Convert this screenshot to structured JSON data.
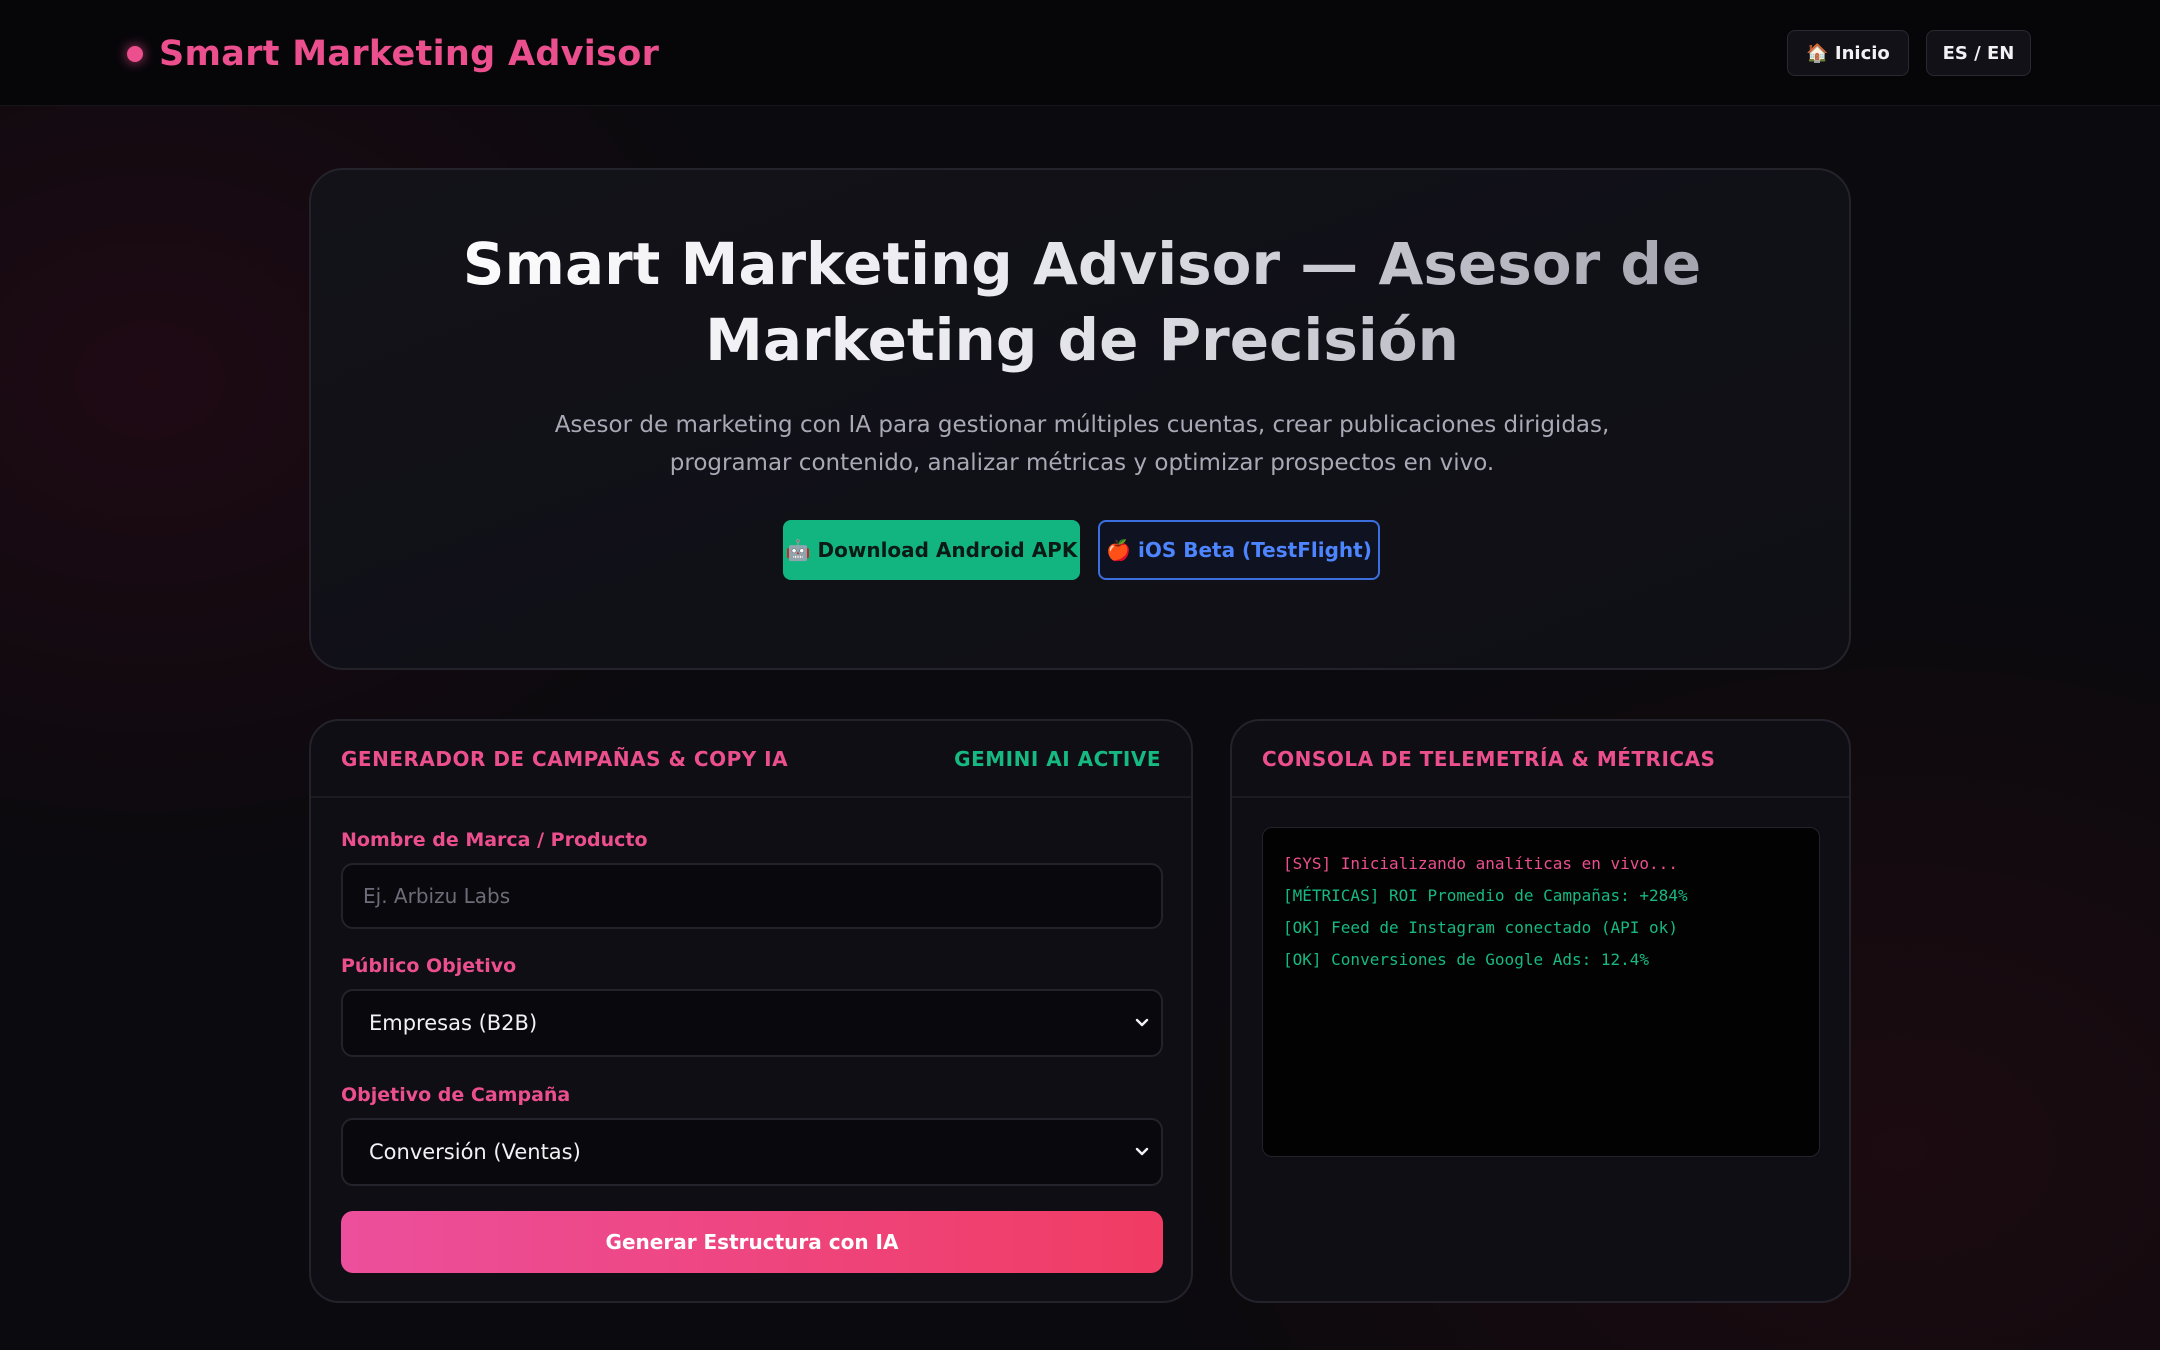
{
  "header": {
    "brand": "Smart Marketing Advisor",
    "nav": {
      "home": "🏠 Inicio",
      "lang": "ES / EN"
    }
  },
  "hero": {
    "title": "Smart Marketing Advisor — Asesor de Marketing de Precisión",
    "subtitle": "Asesor de marketing con IA para gestionar múltiples cuentas, crear publicaciones dirigidas, programar contenido, analizar métricas y optimizar prospectos en vivo.",
    "android_button": "🤖 Download Android APK",
    "ios_button": "🍎 iOS Beta (TestFlight)"
  },
  "generator": {
    "title": "GENERADOR DE CAMPAÑAS & COPY IA",
    "status": "GEMINI AI ACTIVE",
    "brand_label": "Nombre de Marca / Producto",
    "brand_placeholder": "Ej. Arbizu Labs",
    "audience_label": "Público Objetivo",
    "audience_value": "Empresas (B2B)",
    "goal_label": "Objetivo de Campaña",
    "goal_value": "Conversión (Ventas)",
    "generate_button": "Generar Estructura con IA"
  },
  "console": {
    "title": "CONSOLA DE TELEMETRÍA & MÉTRICAS",
    "lines": [
      {
        "text": "[SYS] Inicializando analíticas en vivo...",
        "color": "#ec4f8d"
      },
      {
        "text": "[MÉTRICAS] ROI Promedio de Campañas: +284%",
        "color": "#16b981"
      },
      {
        "text": "[OK] Feed de Instagram conectado (API ok)",
        "color": "#16b981"
      },
      {
        "text": "[OK] Conversiones de Google Ads: 12.4%",
        "color": "#16b981"
      }
    ]
  },
  "colors": {
    "accent": "#ec4f8d",
    "success": "#16b981",
    "ios_blue": "#4d84ff"
  }
}
